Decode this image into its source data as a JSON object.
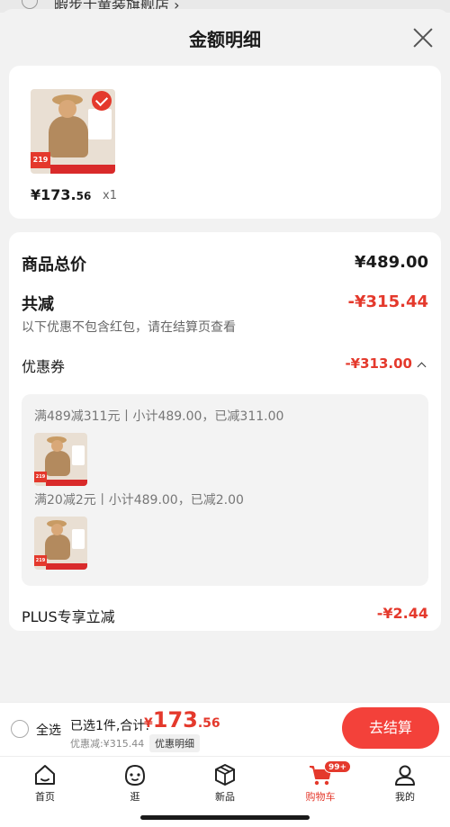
{
  "background_store": {
    "name": "暇步士童装旗舰店 ›"
  },
  "sheet": {
    "title": "金额明细"
  },
  "product": {
    "price_int": "¥173.",
    "price_dec": "56",
    "qty": "x1",
    "thumb_price_tag": "219",
    "thumb_band_text": "限时立减"
  },
  "details": {
    "goods_total_label": "商品总价",
    "goods_total_value": "¥489.00",
    "reduction_label": "共减",
    "reduction_value": "-¥315.44",
    "reduction_note": "以下优惠不包含红包，请在结算页查看",
    "coupon_label": "优惠券",
    "coupon_value": "-¥313.00",
    "coupons": [
      {
        "text": "满489减311元丨小计489.00，已减311.00"
      },
      {
        "text": "满20减2元丨小计489.00，已减2.00"
      }
    ],
    "plus_label": "PLUS专享立减",
    "plus_value": "-¥2.44"
  },
  "checkout": {
    "select_all": "全选",
    "summary": "已选1件,合计:",
    "total_yen": "¥",
    "total_int": "173",
    "total_dec": ".56",
    "discount_line": "优惠减:¥315.44",
    "detail_tag": "优惠明细",
    "button": "去结算"
  },
  "tabbar": {
    "items": [
      {
        "label": "首页",
        "icon": "home-icon"
      },
      {
        "label": "逛",
        "icon": "face-icon"
      },
      {
        "label": "新品",
        "icon": "box-icon"
      },
      {
        "label": "购物车",
        "icon": "cart-icon",
        "badge": "99+"
      },
      {
        "label": "我的",
        "icon": "person-icon"
      }
    ]
  },
  "colors": {
    "accent": "#e4392c",
    "button": "#f3413a"
  }
}
